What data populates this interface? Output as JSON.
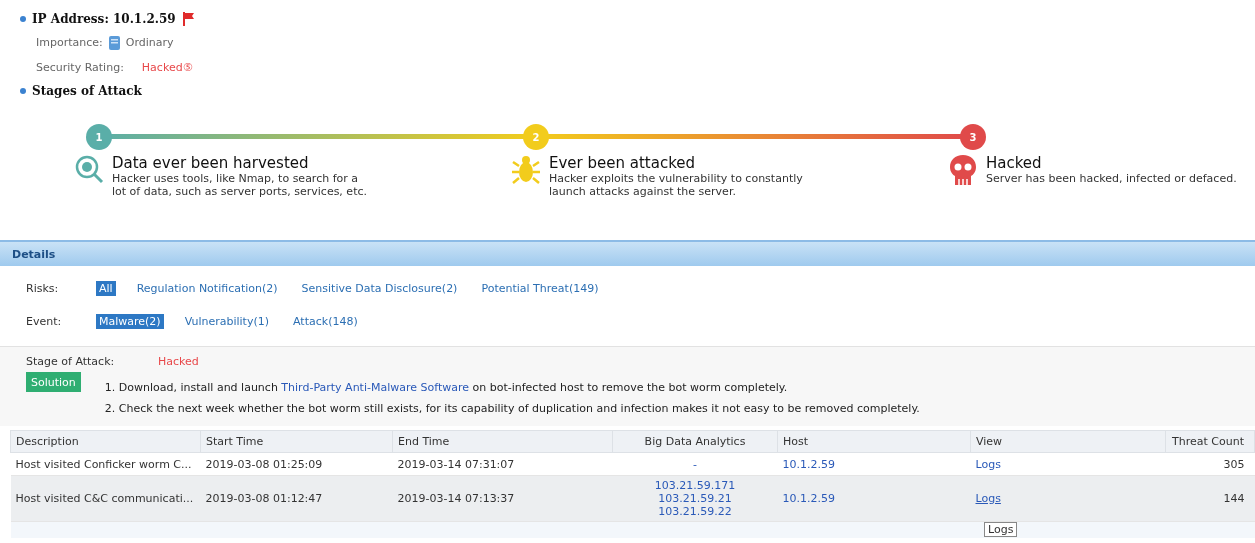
{
  "summary": {
    "ip_label": "IP Address: 10.1.2.59",
    "flagged": true,
    "importance_label": "Importance:",
    "importance_value": "Ordinary",
    "rating_label": "Security Rating:",
    "rating_value": "Hacked",
    "rating_mark": "⑤"
  },
  "stages_heading": "Stages of Attack",
  "stages": [
    {
      "number": "1",
      "title": "Data ever been harvested",
      "text": "Hacker uses tools, like Nmap, to search for a lot of data, such as server ports, services, etc.",
      "color": "#5aaea8",
      "kind": "scan"
    },
    {
      "number": "2",
      "title": "Ever been attacked",
      "text": "Hacker exploits the vulnerability to constantly launch attacks against the server.",
      "color": "#f2cc1c",
      "kind": "bug"
    },
    {
      "number": "3",
      "title": "Hacked",
      "text": "Server has been hacked, infected or defaced.",
      "color": "#e04a4a",
      "kind": "skull"
    }
  ],
  "details": {
    "title": "Details",
    "risks_label": "Risks:",
    "risks": [
      {
        "label": "All",
        "selected": true
      },
      {
        "label": "Regulation Notification(2)",
        "selected": false
      },
      {
        "label": "Sensitive Data Disclosure(2)",
        "selected": false
      },
      {
        "label": "Potential Threat(149)",
        "selected": false
      }
    ],
    "event_label": "Event:",
    "events": [
      {
        "label": "Malware(2)",
        "selected": true
      },
      {
        "label": "Vulnerability(1)",
        "selected": false
      },
      {
        "label": "Attack(148)",
        "selected": false
      }
    ],
    "stage_label": "Stage of Attack:",
    "stage_value": "Hacked",
    "solution_button": "Solution",
    "steps": [
      {
        "before": "1. Download, install and launch ",
        "link": "Third-Party Anti-Malware Software",
        "after": " on bot-infected host to remove the bot worm completely."
      },
      {
        "before": "2. Check the next week whether the bot worm still exists, for its capability of duplication and infection makes it not easy to be removed completely."
      }
    ]
  },
  "table": {
    "columns": [
      "Description",
      "Start Time",
      "End Time",
      "Big Data Analytics",
      "Host",
      "View",
      "Threat Count"
    ],
    "rows": [
      {
        "description": "Host visited Conficker worm C...",
        "start": "2019-03-08 01:25:09",
        "end": "2019-03-14 07:31:07",
        "analytics": [
          "-"
        ],
        "host": "10.1.2.59",
        "view": "Logs",
        "count": "305",
        "selected": false
      },
      {
        "description": "Host visited C&C communicati...",
        "start": "2019-03-08 01:12:47",
        "end": "2019-03-14 07:13:37",
        "analytics": [
          "103.21.59.171",
          "103.21.59.21",
          "103.21.59.22"
        ],
        "host": "10.1.2.59",
        "view": "Logs",
        "count": "144",
        "selected": true
      }
    ]
  },
  "tooltip": "Logs"
}
